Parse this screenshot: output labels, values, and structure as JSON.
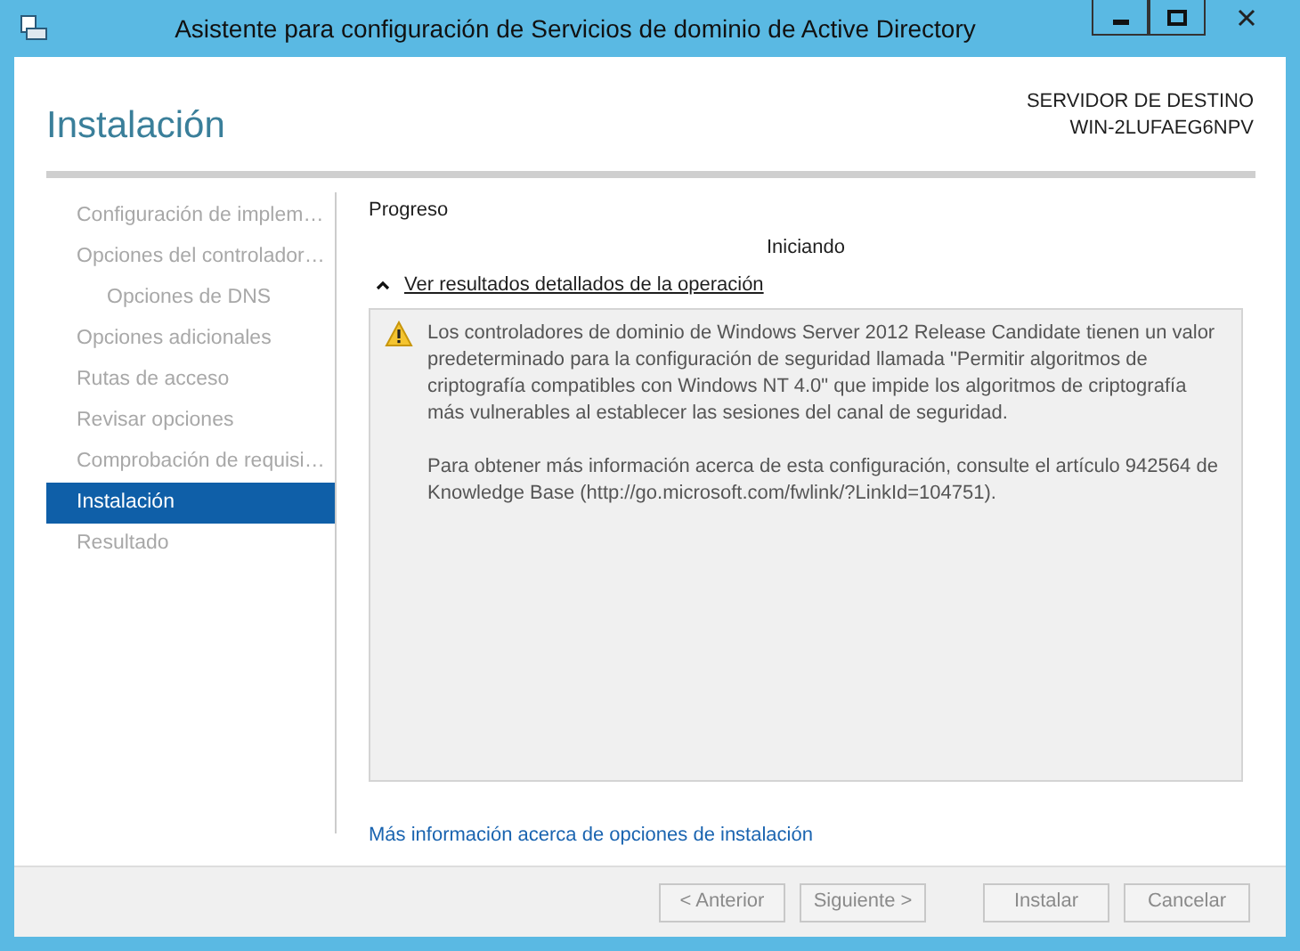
{
  "window": {
    "title": "Asistente para configuración de Servicios de dominio de Active Directory"
  },
  "header": {
    "title": "Instalación",
    "server_label": "SERVIDOR DE DESTINO",
    "server_name": "WIN-2LUFAEG6NPV"
  },
  "sidebar": {
    "items": [
      {
        "label": "Configuración de implem…",
        "selected": false
      },
      {
        "label": "Opciones del controlador…",
        "selected": false,
        "children": [
          {
            "label": "Opciones de DNS",
            "selected": false
          }
        ]
      },
      {
        "label": "Opciones adicionales",
        "selected": false
      },
      {
        "label": "Rutas de acceso",
        "selected": false
      },
      {
        "label": "Revisar opciones",
        "selected": false
      },
      {
        "label": "Comprobación de requisi…",
        "selected": false
      },
      {
        "label": "Instalación",
        "selected": true
      },
      {
        "label": "Resultado",
        "selected": false
      }
    ]
  },
  "progress": {
    "label": "Progreso",
    "status": "Iniciando"
  },
  "details": {
    "toggle": "Ver resultados detallados de la operación",
    "expanded": true,
    "messages": [
      {
        "kind": "warning",
        "paragraphs": [
          "Los controladores de dominio de Windows Server 2012 Release Candidate tienen un valor predeterminado para la configuración de seguridad llamada \"Permitir algoritmos de criptografía compatibles con Windows NT 4.0\" que impide los algoritmos de criptografía más vulnerables al establecer las sesiones del canal de seguridad.",
          "Para obtener más información acerca de esta configuración, consulte el artículo 942564 de Knowledge Base (http://go.microsoft.com/fwlink/?LinkId=104751)."
        ]
      }
    ]
  },
  "link": "Más información acerca de opciones de instalación",
  "buttons": [
    {
      "label": "< Anterior",
      "disabled": true
    },
    {
      "label": "Siguiente >",
      "disabled": true
    },
    {
      "label": "Instalar",
      "disabled": true
    },
    {
      "label": "Cancelar",
      "disabled": true
    }
  ]
}
